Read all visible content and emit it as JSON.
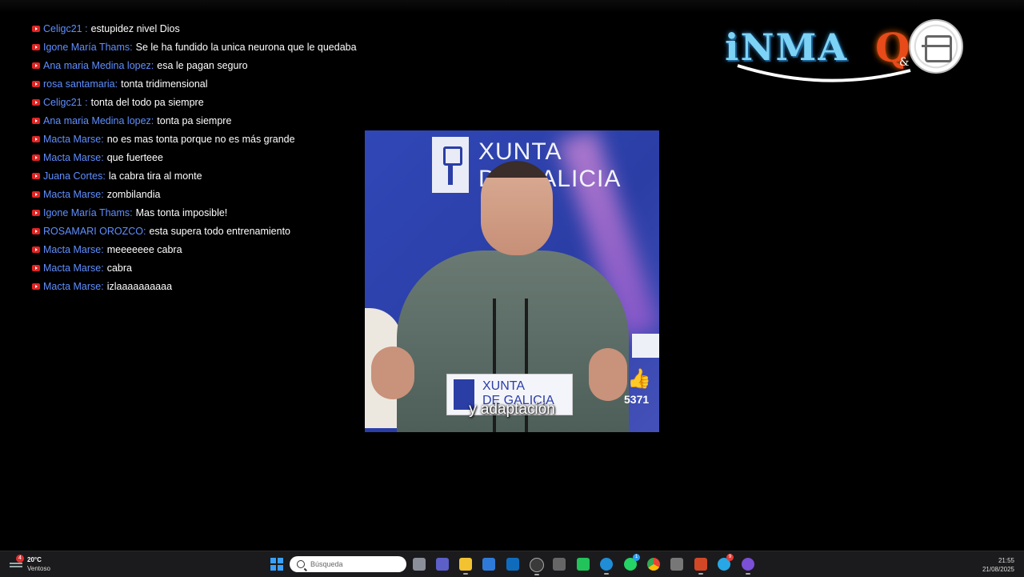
{
  "chat": {
    "messages": [
      {
        "author": "Celigc21 :",
        "text": "estupidez nivel Dios"
      },
      {
        "author": "Igone María Thams:",
        "text": "Se le ha fundido la unica neurona que le quedaba"
      },
      {
        "author": "Ana maria Medina lopez:",
        "text": "esa le pagan seguro"
      },
      {
        "author": "rosa santamaria:",
        "text": "tonta tridimensional"
      },
      {
        "author": "Celigc21 :",
        "text": "tonta del todo pa siempre"
      },
      {
        "author": "Ana maria Medina lopez:",
        "text": "tonta pa siempre"
      },
      {
        "author": "Macta Marse:",
        "text": "no es mas tonta porque no es más grande"
      },
      {
        "author": "Macta Marse:",
        "text": "que fuerteee"
      },
      {
        "author": "Juana Cortes:",
        "text": "la cabra tira al monte"
      },
      {
        "author": "Macta Marse:",
        "text": "zombilandia"
      },
      {
        "author": "Igone María Thams:",
        "text": "Mas tonta imposible!"
      },
      {
        "author": "ROSAMARI OROZCO:",
        "text": "esta supera todo entrenamiento"
      },
      {
        "author": "Macta Marse:",
        "text": "meeeeeee cabra"
      },
      {
        "author": "Macta Marse:",
        "text": "cabra"
      },
      {
        "author": "Macta Marse:",
        "text": "izlaaaaaaaaaa"
      }
    ]
  },
  "logo": {
    "word": "iNMA",
    "q": "Q",
    "amp": "&"
  },
  "video": {
    "backdrop_line1": "XUNTA",
    "backdrop_line2": "DE GALICIA",
    "podium_line1": "XUNTA",
    "podium_line2": "DE GALICIA",
    "caption": "y adaptación",
    "like_count": "5371"
  },
  "taskbar": {
    "weather_badge": "4",
    "weather_temp": "20°C",
    "weather_desc": "Ventoso",
    "search_placeholder": "Búsqueda",
    "time": "21:55",
    "date": "21/08/2025",
    "badges": {
      "whatsapp": "1",
      "telegram": "9"
    }
  },
  "colors": {
    "author": "#5f8fff",
    "background": "#000000",
    "taskbar": "#1b1b1d"
  }
}
